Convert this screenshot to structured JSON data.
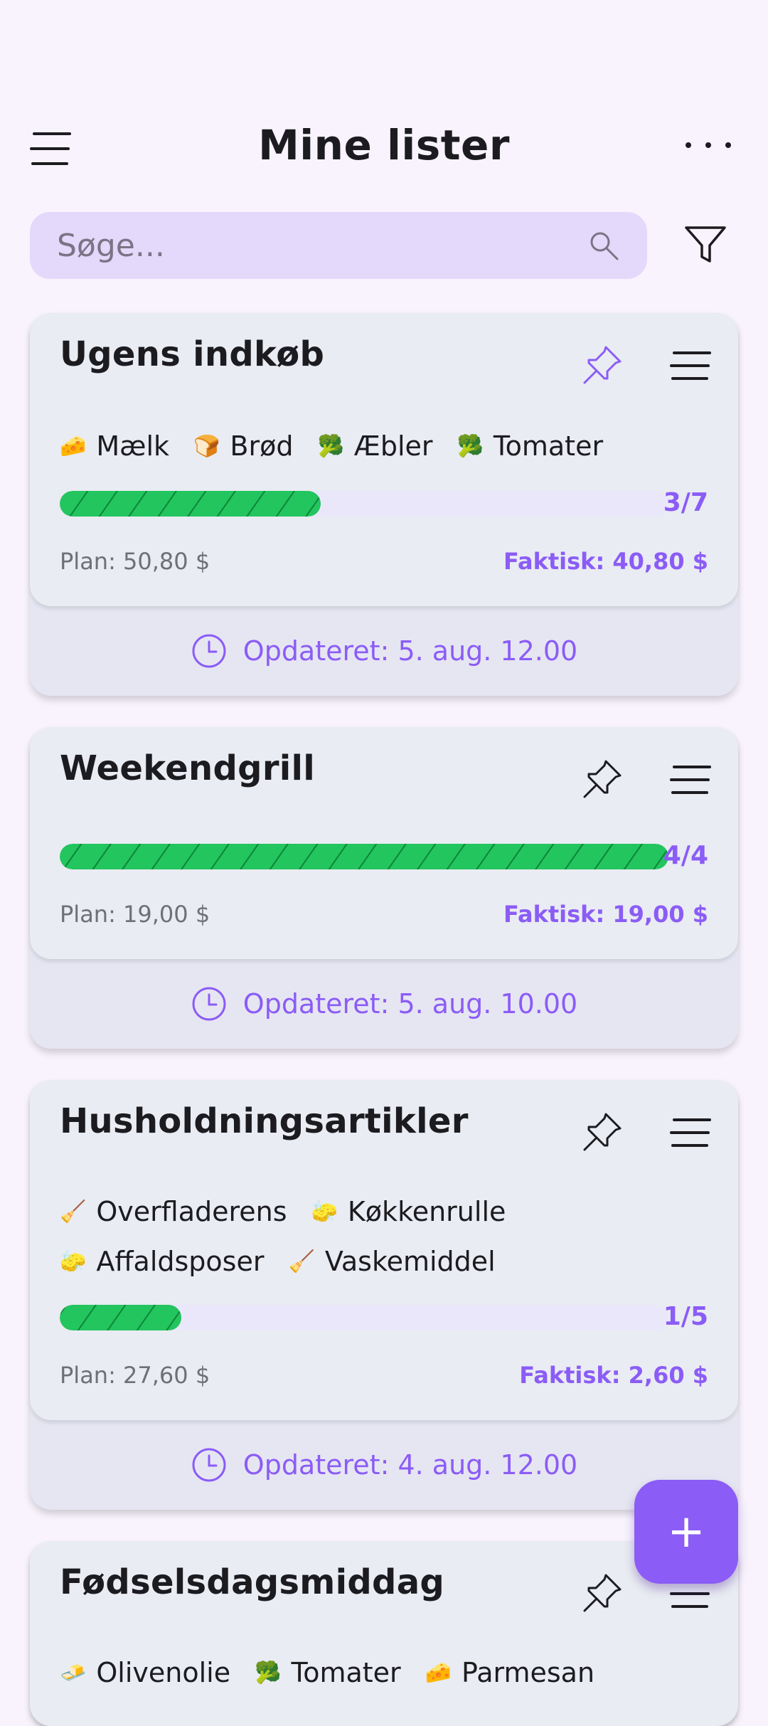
{
  "header": {
    "title": "Mine lister"
  },
  "search": {
    "placeholder": "Søge..."
  },
  "colors": {
    "accent": "#8b5cf6",
    "progress": "#22c55e",
    "search_bg": "#e4d8fb"
  },
  "lists": [
    {
      "title": "Ugens indkøb",
      "pinned": true,
      "chips": [
        {
          "icon": "cheese",
          "emoji": "🧀",
          "label": "Mælk"
        },
        {
          "icon": "bread",
          "emoji": "🍞",
          "label": "Brød"
        },
        {
          "icon": "broccoli",
          "emoji": "🥦",
          "label": "Æbler"
        },
        {
          "icon": "broccoli",
          "emoji": "🥦",
          "label": "Tomater"
        }
      ],
      "progress": {
        "done": 3,
        "total": 7,
        "label": "3/7"
      },
      "plan": "Plan: 50,80 $",
      "actual": "Faktisk: 40,80 $",
      "updated": "Opdateret: 5. aug. 12.00"
    },
    {
      "title": "Weekendgrill",
      "pinned": false,
      "chips": [],
      "progress": {
        "done": 4,
        "total": 4,
        "label": "4/4"
      },
      "plan": "Plan: 19,00 $",
      "actual": "Faktisk: 19,00 $",
      "updated": "Opdateret: 5. aug. 10.00"
    },
    {
      "title": "Husholdningsartikler",
      "pinned": false,
      "chips": [
        {
          "icon": "broom",
          "emoji": "🧹",
          "label": "Overfladerens"
        },
        {
          "icon": "sponge",
          "emoji": "🧽",
          "label": "Køkkenrulle"
        },
        {
          "icon": "sponge",
          "emoji": "🧽",
          "label": "Affaldsposer"
        },
        {
          "icon": "broom",
          "emoji": "🧹",
          "label": "Vaskemiddel"
        }
      ],
      "progress": {
        "done": 1,
        "total": 5,
        "label": "1/5"
      },
      "plan": "Plan: 27,60 $",
      "actual": "Faktisk: 2,60 $",
      "updated": "Opdateret: 4. aug. 12.00"
    },
    {
      "title": "Fødselsdagsmiddag",
      "pinned": false,
      "chips": [
        {
          "icon": "butter",
          "emoji": "🧈",
          "label": "Olivenolie"
        },
        {
          "icon": "broccoli",
          "emoji": "🥦",
          "label": "Tomater"
        },
        {
          "icon": "cheese",
          "emoji": "🧀",
          "label": "Parmesan"
        }
      ]
    }
  ],
  "fab": {
    "label": "+"
  }
}
